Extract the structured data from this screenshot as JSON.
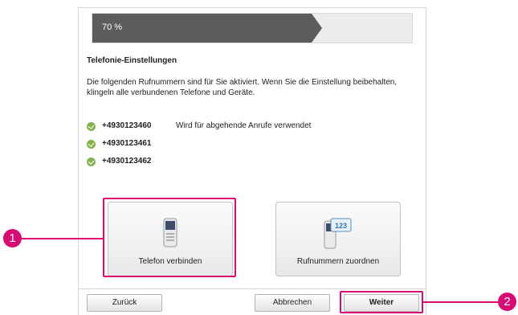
{
  "progress": {
    "label": "70 %",
    "value": 0.7
  },
  "section_title": "Telefonie-Einstellungen",
  "description": "Die folgenden Rufnummern sind für Sie aktiviert. Wenn Sie die Einstellung beibehalten, klingeln alle verbundenen Telefone und Geräte.",
  "numbers": [
    {
      "number": "+4930123460",
      "note": "Wird für abgehende Anrufe verwendet"
    },
    {
      "number": "+4930123461"
    },
    {
      "number": "+4930123462"
    }
  ],
  "tiles": {
    "connect_phone": {
      "label": "Telefon verbinden",
      "icon": "phone-icon"
    },
    "assign_numbers": {
      "label": "Rufnummern zuordnen",
      "icon": "phone-numbers-icon",
      "icon_text": "123"
    }
  },
  "buttons": {
    "back": "Zurück",
    "cancel": "Abbrechen",
    "next": "Weiter"
  },
  "callouts": {
    "one": "1",
    "two": "2"
  },
  "colors": {
    "accent": "#d90a73",
    "progress_fill": "#5c5c5c",
    "check": "#82b44b"
  }
}
